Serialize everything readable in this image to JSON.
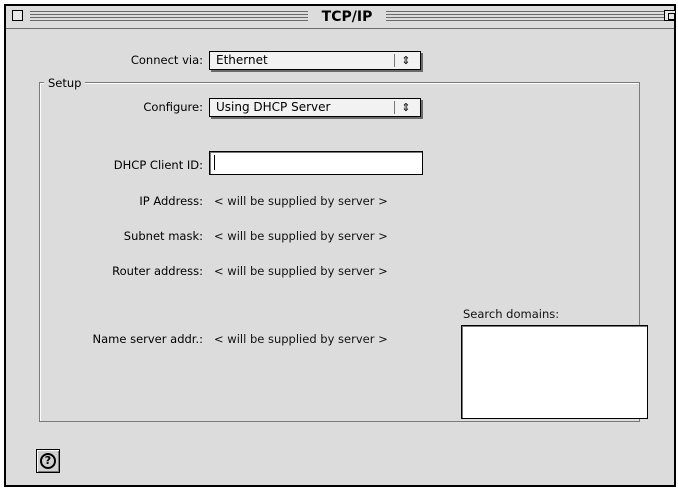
{
  "window": {
    "title": "TCP/IP"
  },
  "connect": {
    "label": "Connect via:",
    "value": "Ethernet",
    "popup_icon": "up-down-arrows-icon"
  },
  "setup": {
    "group_label": "Setup",
    "configure_label": "Configure:",
    "configure_value": "Using DHCP Server",
    "dhcp_label": "DHCP Client ID:",
    "dhcp_value": "",
    "ip_label": "IP Address:",
    "ip_value": "< will be supplied by server >",
    "subnet_label": "Subnet mask:",
    "subnet_value": "< will be supplied by server >",
    "router_label": "Router address:",
    "router_value": "< will be supplied by server >",
    "nameserver_label": "Name server addr.:",
    "nameserver_value": "< will be supplied by server >",
    "search_domains_label": "Search domains:",
    "search_domains_value": ""
  },
  "help": {
    "icon": "question-mark-icon",
    "glyph": "?"
  },
  "colors": {
    "window_bg": "#dcdcdc",
    "field_bg": "#ffffff"
  }
}
